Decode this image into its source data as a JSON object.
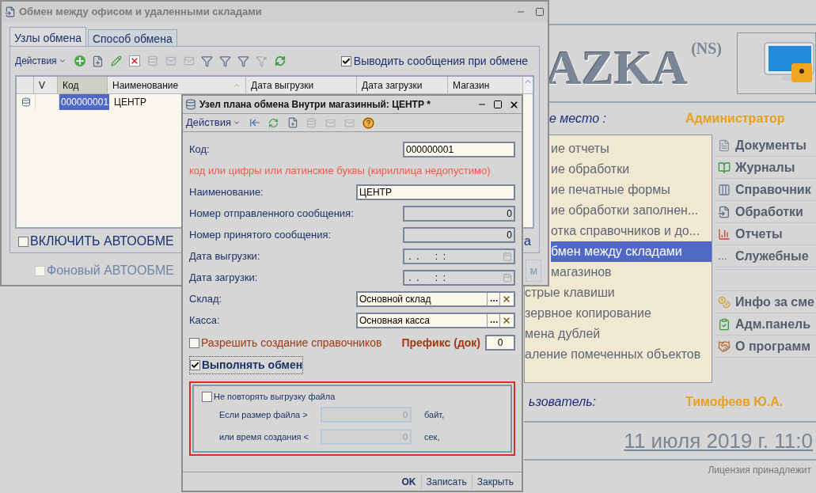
{
  "main": {
    "logo": "AZKA",
    "logo_sup": "(NS)",
    "workplace_label": "е место :",
    "role": "Администратор",
    "menu": [
      {
        "label": "ие отчеты",
        "selected": false
      },
      {
        "label": "ие обработки",
        "selected": false
      },
      {
        "label": "ие печатные формы",
        "selected": false
      },
      {
        "label": "ие обработки заполнен...",
        "selected": false
      },
      {
        "label": "отка справочников и до...",
        "selected": false
      },
      {
        "label": "бмен между складами",
        "selected": true
      },
      {
        "label": "магазинов",
        "selected": false
      },
      {
        "label": "стрые клавиши",
        "selected": false
      },
      {
        "label": "зервное копирование",
        "selected": false
      },
      {
        "label": "мена дублей",
        "selected": false
      },
      {
        "label": "аление помеченных объектов",
        "selected": false
      }
    ],
    "nav_top": [
      {
        "kind": "document",
        "label": "Документы"
      },
      {
        "kind": "journal",
        "label": "Журналы"
      },
      {
        "kind": "catalog",
        "label": "Справочник"
      },
      {
        "kind": "processing",
        "label": "Обработки"
      },
      {
        "kind": "report",
        "label": "Отчеты"
      },
      {
        "kind": "dots",
        "marker": "...",
        "label": "Служебные"
      }
    ],
    "nav_bottom": [
      {
        "kind": "coins",
        "label": "Инфо за сме"
      },
      {
        "kind": "clipboard",
        "label": "Адм.панель"
      },
      {
        "kind": "handshake",
        "label": "О программ"
      }
    ],
    "user_label": "ьзователь:",
    "user": "Тимофеев Ю.А.",
    "date": "11 июля 2019 г. 11:0",
    "license": "Лицензия принадлежит"
  },
  "exchange_window": {
    "title": "Обмен между офисом и удаленными складами",
    "tabs": [
      {
        "label": "Узлы обмена",
        "selected": true
      },
      {
        "label": "Способ обмена",
        "selected": false
      }
    ],
    "actions": "Действия",
    "show_messages": {
      "label": "Выводить сообщения при обмене",
      "checked": true
    },
    "table": {
      "columns": [
        "V",
        "Код",
        "Наименование",
        "Дата выгрузки",
        "Дата загрузки",
        "Магазин"
      ],
      "rows": [
        {
          "code": "000000001",
          "name": "ЦЕНТР",
          "selected": true
        }
      ]
    },
    "auto_exchange": {
      "label": "ВКЛЮЧИТЬ АВТООБМЕ",
      "checked": false
    },
    "background_exchange": {
      "label": "Фоновый АВТООБМЕ",
      "checked": false,
      "disabled": true
    },
    "partial_label": "а",
    "partial_button": "м"
  },
  "node_dialog": {
    "title": "Узел плана обмена Внутри магазинный: ЦЕНТР *",
    "actions": "Действия",
    "fields": [
      {
        "kind": "code",
        "label": "Код:",
        "value": "000000001"
      },
      {
        "kind": "note",
        "label": "код или цифры или латинские буквы (кириллица недопустимо)"
      },
      {
        "kind": "text",
        "label": "Наименование:",
        "value": "ЦЕНТР"
      },
      {
        "kind": "number",
        "label": "Номер отправленного сообщения:",
        "value": "0"
      },
      {
        "kind": "number",
        "label": "Номер принятого сообщения:",
        "value": "0"
      },
      {
        "kind": "date",
        "label": "Дата выгрузки:",
        "value": " .  .      :  :"
      },
      {
        "kind": "date",
        "label": "Дата загрузки:",
        "value": " .  .      :  :"
      },
      {
        "kind": "ref",
        "label": "Склад:",
        "value": "Основной склад"
      },
      {
        "kind": "ref",
        "label": "Касса:",
        "value": "Основная касса"
      }
    ],
    "allow_catalogs": {
      "label": "Разрешить создание справочников",
      "checked": false
    },
    "prefix": {
      "label": "Префикс (док)",
      "value": "0"
    },
    "do_exchange": {
      "label": "Выполнять обмен",
      "checked": true
    },
    "no_repeat": {
      "label": "Не повторять выгрузку файла",
      "checked": false
    },
    "limits": [
      {
        "label": "Если размер файла >",
        "value": "0",
        "unit": "байт,",
        "disabled": true
      },
      {
        "label": "или время создания <",
        "value": "0",
        "unit": "сек,",
        "disabled": true
      }
    ],
    "buttons": [
      {
        "label": "OK",
        "default": true
      },
      {
        "label": "Записать",
        "default": false
      },
      {
        "label": "Закрыть",
        "default": false
      }
    ]
  }
}
